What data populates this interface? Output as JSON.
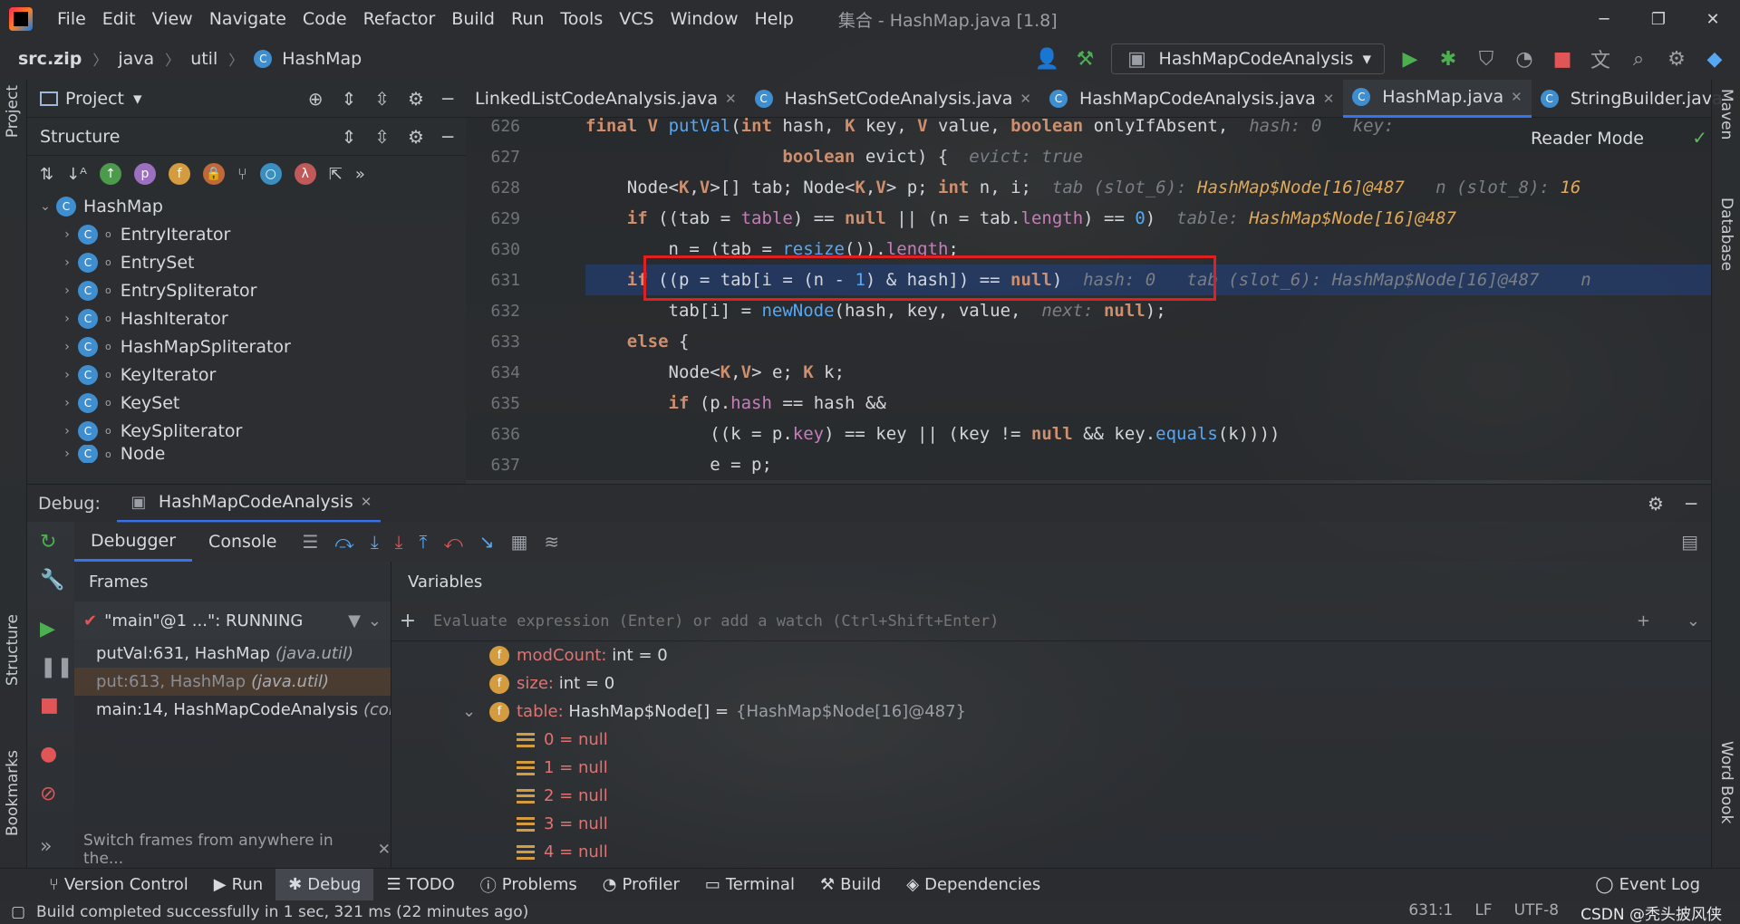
{
  "titlebar": {
    "menu": [
      "File",
      "Edit",
      "View",
      "Navigate",
      "Code",
      "Refactor",
      "Build",
      "Run",
      "Tools",
      "VCS",
      "Window",
      "Help"
    ],
    "window_title": "集合 - HashMap.java [1.8]"
  },
  "navbar": {
    "crumbs": [
      "src.zip",
      "java",
      "util",
      "HashMap"
    ],
    "run_config": "HashMapCodeAnalysis"
  },
  "left_stripe": {
    "project": "Project",
    "structure": "Structure",
    "bookmarks": "Bookmarks"
  },
  "right_stripe": {
    "maven": "Maven",
    "database": "Database",
    "word_book": "Word Book"
  },
  "project_panel": {
    "title": "Project"
  },
  "structure_panel": {
    "title": "Structure",
    "root": "HashMap",
    "items": [
      "EntryIterator",
      "EntrySet",
      "EntrySpliterator",
      "HashIterator",
      "HashMapSpliterator",
      "KeyIterator",
      "KeySet",
      "KeySpliterator",
      "Node"
    ]
  },
  "editor": {
    "tabs": [
      "LinkedListCodeAnalysis.java",
      "HashSetCodeAnalysis.java",
      "HashMapCodeAnalysis.java",
      "HashMap.java",
      "StringBuilder.java"
    ],
    "active_tab": "HashMap.java",
    "reader_mode": "Reader Mode",
    "line_numbers": [
      "626",
      "627",
      "628",
      "629",
      "630",
      "631",
      "632",
      "633",
      "634",
      "635",
      "636",
      "637"
    ],
    "hints": {
      "l626_hash": "hash: 0",
      "l626_key": "key:",
      "l627_evict": "evict: true",
      "l628_tab": "tab (slot_6):",
      "l628_tab_val": "HashMap$Node[16]@487",
      "l628_n": "n (slot_8):",
      "l628_n_val": "16",
      "l629_table": "table:",
      "l629_table_val": "HashMap$Node[16]@487",
      "l631_hash": "hash: 0",
      "l631_tab": "tab (slot_6): HashMap$Node[16]@487",
      "l631_n": "n",
      "l632_next": "next:"
    }
  },
  "debug": {
    "label": "Debug:",
    "session": "HashMapCodeAnalysis",
    "tabs": [
      "Debugger",
      "Console"
    ],
    "frames_title": "Frames",
    "thread": "\"main\"@1 ...\": RUNNING",
    "frames": [
      {
        "method": "putVal:631, HashMap",
        "pkg": "(java.util)"
      },
      {
        "method": "put:613, HashMap",
        "pkg": "(java.util)"
      },
      {
        "method": "main:14, HashMapCodeAnalysis",
        "pkg": "(com"
      }
    ],
    "frames_footer": "Switch frames from anywhere in the...",
    "variables_title": "Variables",
    "eval_placeholder": "Evaluate expression (Enter) or add a watch (Ctrl+Shift+Enter)",
    "variables": [
      {
        "name": "modCount:",
        "type": "int",
        "value": "= 0"
      },
      {
        "name": "size:",
        "type": "int",
        "value": "= 0"
      },
      {
        "name": "table:",
        "type": "HashMap$Node[]",
        "value": "=",
        "ref": "{HashMap$Node[16]@487}"
      }
    ],
    "table_elements": [
      "0 = null",
      "1 = null",
      "2 = null",
      "3 = null",
      "4 = null"
    ]
  },
  "bottom_bar": {
    "items": [
      "Version Control",
      "Run",
      "Debug",
      "TODO",
      "Problems",
      "Profiler",
      "Terminal",
      "Build",
      "Dependencies"
    ],
    "active": "Debug",
    "event_log": "Event Log"
  },
  "status_bar": {
    "message": "Build completed successfully in 1 sec, 321 ms (22 minutes ago)",
    "position": "631:1",
    "line_sep": "LF",
    "encoding": "UTF-8",
    "watermark": "CSDN @秃头披风侠"
  },
  "colors": {
    "accent": "#3574f0",
    "highlight_box": "#e02020",
    "run_green": "#4caf50",
    "stop_red": "#e05555"
  }
}
